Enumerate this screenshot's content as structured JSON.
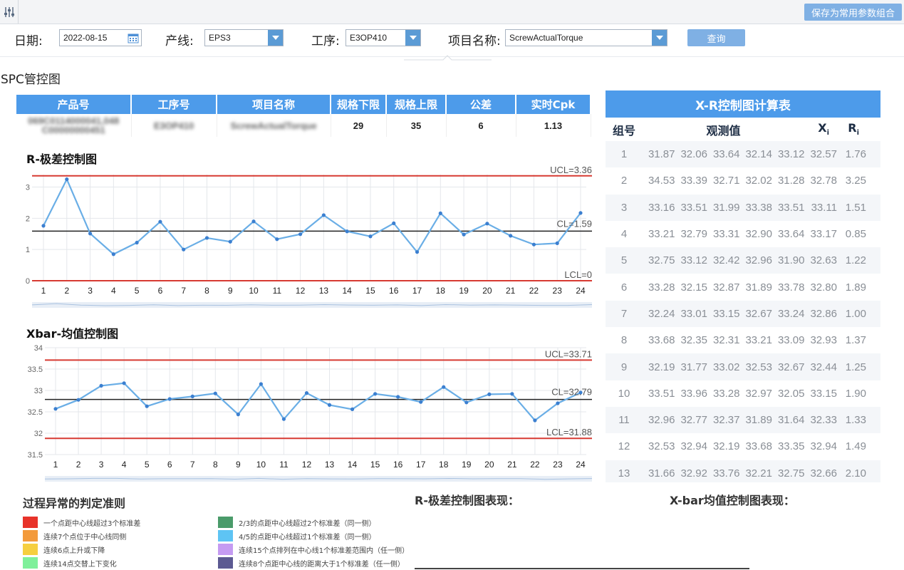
{
  "toolbar": {
    "save_label": "保存为常用参数组合",
    "menu_icon": "sliders-icon"
  },
  "filters": {
    "date_label": "日期:",
    "date_value": "2022-08-15",
    "line_label": "产线:",
    "line_value": "EPS3",
    "process_label": "工序:",
    "process_value": "E3OP410",
    "item_label": "项目名称:",
    "item_value": "ScrewActualTorque",
    "query_label": "查询"
  },
  "section_title": "SPC管控图",
  "info_table": {
    "headers": [
      "产品号",
      "工序号",
      "项目名称",
      "规格下限",
      "规格上限",
      "公差",
      "实时Cpk"
    ],
    "row": {
      "product": "069C0114000041,048 C00000000451",
      "process": "E3OP410",
      "item": "ScrewActualTorque",
      "lsl": "29",
      "usl": "35",
      "tolerance": "6",
      "cpk": "1.13"
    }
  },
  "chart_data": [
    {
      "type": "line",
      "title": "R-极差控制图",
      "x": [
        1,
        2,
        3,
        4,
        5,
        6,
        7,
        8,
        9,
        10,
        11,
        12,
        13,
        14,
        15,
        16,
        17,
        18,
        19,
        20,
        21,
        22,
        23,
        24
      ],
      "series": [
        {
          "values": [
            1.76,
            3.25,
            1.51,
            0.85,
            1.22,
            1.89,
            1.0,
            1.37,
            1.25,
            1.9,
            1.33,
            1.49,
            2.1,
            1.58,
            1.42,
            1.84,
            0.92,
            2.16,
            1.48,
            1.83,
            1.44,
            1.16,
            1.2,
            2.17
          ]
        }
      ],
      "ylim": [
        0,
        3.4
      ],
      "yticks": [
        0,
        1,
        2,
        3
      ],
      "lines": {
        "UCL": 3.36,
        "CL": 1.59,
        "LCL": 0
      },
      "labels": {
        "ucl": "UCL=3.36",
        "cl": "CL=1.59",
        "lcl": "LCL=0"
      },
      "grid": true
    },
    {
      "type": "line",
      "title": "Xbar-均值控制图",
      "x": [
        1,
        2,
        3,
        4,
        5,
        6,
        7,
        8,
        9,
        10,
        11,
        12,
        13,
        14,
        15,
        16,
        17,
        18,
        19,
        20,
        21,
        22,
        23,
        24
      ],
      "series": [
        {
          "values": [
            32.57,
            32.78,
            33.11,
            33.17,
            32.63,
            32.8,
            32.86,
            32.93,
            32.44,
            33.15,
            32.33,
            32.94,
            32.66,
            32.56,
            32.92,
            32.85,
            32.73,
            33.08,
            32.72,
            32.91,
            32.92,
            32.3,
            32.7,
            32.95
          ]
        }
      ],
      "ylim": [
        31.5,
        34
      ],
      "yticks": [
        31.5,
        32,
        32.5,
        33,
        33.5,
        34
      ],
      "lines": {
        "UCL": 33.71,
        "CL": 32.79,
        "LCL": 31.88
      },
      "labels": {
        "ucl": "UCL=33.71",
        "cl": "CL=32.79",
        "lcl": "LCL=31.88"
      },
      "grid": true
    }
  ],
  "calc_table": {
    "title": "X-R控制图计算表",
    "headers": {
      "group": "组号",
      "obs": "观测值",
      "xi": "X",
      "ri": "R",
      "sub": "i"
    },
    "rows": [
      [
        "1",
        "31.87",
        "32.06",
        "33.64",
        "32.14",
        "33.12",
        "32.57",
        "1.76"
      ],
      [
        "2",
        "34.53",
        "33.39",
        "32.71",
        "32.02",
        "31.28",
        "32.78",
        "3.25"
      ],
      [
        "3",
        "33.16",
        "33.51",
        "31.99",
        "33.38",
        "33.51",
        "33.11",
        "1.51"
      ],
      [
        "4",
        "33.21",
        "32.79",
        "33.31",
        "32.90",
        "33.64",
        "33.17",
        "0.85"
      ],
      [
        "5",
        "32.75",
        "33.12",
        "32.42",
        "32.96",
        "31.90",
        "32.63",
        "1.22"
      ],
      [
        "6",
        "33.28",
        "32.15",
        "32.87",
        "31.89",
        "33.78",
        "32.80",
        "1.89"
      ],
      [
        "7",
        "32.24",
        "33.01",
        "33.15",
        "32.67",
        "33.24",
        "32.86",
        "1.00"
      ],
      [
        "8",
        "33.68",
        "32.35",
        "32.31",
        "33.21",
        "33.09",
        "32.93",
        "1.37"
      ],
      [
        "9",
        "32.19",
        "31.77",
        "33.02",
        "32.53",
        "32.67",
        "32.44",
        "1.25"
      ],
      [
        "10",
        "33.51",
        "33.96",
        "33.28",
        "32.97",
        "32.05",
        "33.15",
        "1.90"
      ],
      [
        "11",
        "32.96",
        "32.77",
        "32.37",
        "31.89",
        "31.64",
        "32.33",
        "1.33"
      ],
      [
        "12",
        "32.53",
        "32.94",
        "32.19",
        "33.68",
        "33.35",
        "32.94",
        "1.49"
      ],
      [
        "13",
        "31.66",
        "32.92",
        "33.76",
        "32.21",
        "32.75",
        "32.66",
        "2.10"
      ]
    ]
  },
  "rules": {
    "title": "过程异常的判定准则",
    "items": [
      {
        "text": "一个点距中心线超过3个标准差",
        "color": "#e8332a"
      },
      {
        "text": "连续7个点位于中心线同侧",
        "color": "#f39a3b"
      },
      {
        "text": "连续6点上升或下降",
        "color": "#f6cf3f"
      },
      {
        "text": "连续14点交替上下变化",
        "color": "#7ff09b"
      },
      {
        "text": "2/3的点距中心线超过2个标准差（同一侧）",
        "color": "#4a9b6a"
      },
      {
        "text": "4/5的点距中心线超过1个标准差（同一侧）",
        "color": "#5ec4f4"
      },
      {
        "text": "连续15个点排列在中心线1个标准差范围内（任一侧）",
        "color": "#c59bf2"
      },
      {
        "text": "连续8个点距中心线的距离大于1个标准差（任一侧）",
        "color": "#5c5a92"
      }
    ]
  },
  "performance": {
    "r_label": "R-极差控制图表现：",
    "x_label": "X-bar均值控制图表现："
  }
}
